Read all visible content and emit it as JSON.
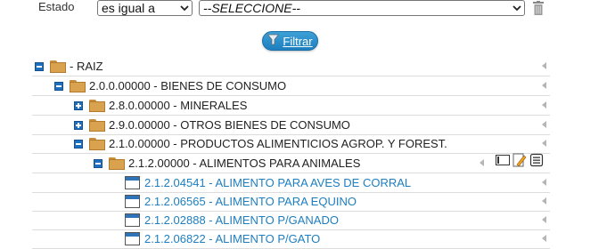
{
  "filter": {
    "field_label": "Estado",
    "operator_value": "es igual a",
    "value_selected": "--SELECCIONE--",
    "filter_button_label": "Filtrar",
    "filter_button_icon": "funnel-icon",
    "delete_icon": "trash-icon"
  },
  "tree": {
    "root": {
      "label": "- RAIZ"
    },
    "n1": {
      "label": "2.0.0.00000 - BIENES DE CONSUMO"
    },
    "n2": {
      "label": "2.8.0.00000 - MINERALES"
    },
    "n3": {
      "label": "2.9.0.00000 - OTROS BIENES DE CONSUMO"
    },
    "n4": {
      "label": "2.1.0.00000 - PRODUCTOS ALIMENTICIOS AGROP. Y FOREST."
    },
    "n5": {
      "label": "2.1.2.00000 - ALIMENTOS PARA ANIMALES"
    },
    "items": [
      {
        "label": "2.1.2.04541 - ALIMENTO PARA AVES DE CORRAL"
      },
      {
        "label": "2.1.2.06565 - ALIMENTO PARA EQUINO"
      },
      {
        "label": "2.1.2.02888 - ALIMENTO P/GANADO"
      },
      {
        "label": "2.1.2.06822 - ALIMENTO P/GATO"
      }
    ],
    "row_actions": [
      "card-icon",
      "pencil-edit-icon",
      "document-list-icon"
    ]
  },
  "colors": {
    "accent": "#1d7fbf",
    "link": "#1d7ec0",
    "folder": "#d9a24f",
    "toggle": "#1f6fc0"
  }
}
